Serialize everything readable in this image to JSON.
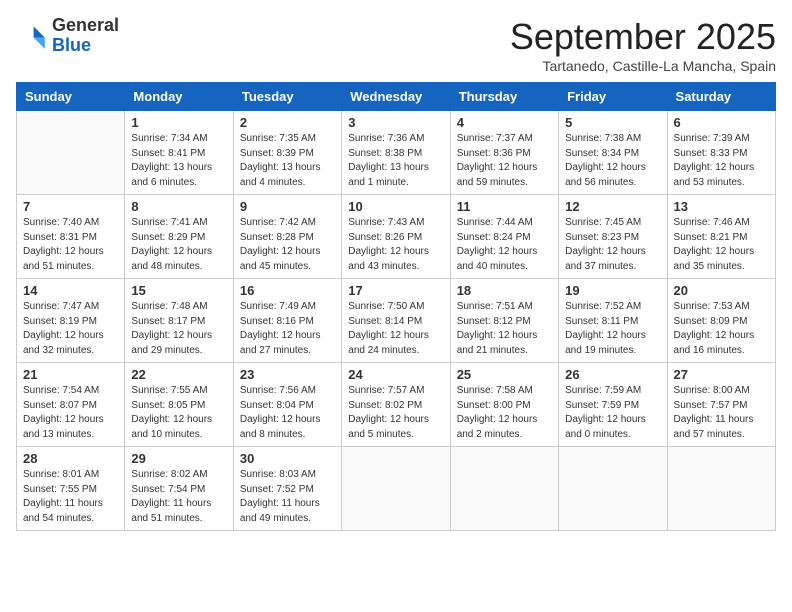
{
  "header": {
    "logo_line1": "General",
    "logo_line2": "Blue",
    "month": "September 2025",
    "location": "Tartanedo, Castille-La Mancha, Spain"
  },
  "days_of_week": [
    "Sunday",
    "Monday",
    "Tuesday",
    "Wednesday",
    "Thursday",
    "Friday",
    "Saturday"
  ],
  "weeks": [
    [
      {
        "day": "",
        "info": ""
      },
      {
        "day": "1",
        "info": "Sunrise: 7:34 AM\nSunset: 8:41 PM\nDaylight: 13 hours\nand 6 minutes."
      },
      {
        "day": "2",
        "info": "Sunrise: 7:35 AM\nSunset: 8:39 PM\nDaylight: 13 hours\nand 4 minutes."
      },
      {
        "day": "3",
        "info": "Sunrise: 7:36 AM\nSunset: 8:38 PM\nDaylight: 13 hours\nand 1 minute."
      },
      {
        "day": "4",
        "info": "Sunrise: 7:37 AM\nSunset: 8:36 PM\nDaylight: 12 hours\nand 59 minutes."
      },
      {
        "day": "5",
        "info": "Sunrise: 7:38 AM\nSunset: 8:34 PM\nDaylight: 12 hours\nand 56 minutes."
      },
      {
        "day": "6",
        "info": "Sunrise: 7:39 AM\nSunset: 8:33 PM\nDaylight: 12 hours\nand 53 minutes."
      }
    ],
    [
      {
        "day": "7",
        "info": "Sunrise: 7:40 AM\nSunset: 8:31 PM\nDaylight: 12 hours\nand 51 minutes."
      },
      {
        "day": "8",
        "info": "Sunrise: 7:41 AM\nSunset: 8:29 PM\nDaylight: 12 hours\nand 48 minutes."
      },
      {
        "day": "9",
        "info": "Sunrise: 7:42 AM\nSunset: 8:28 PM\nDaylight: 12 hours\nand 45 minutes."
      },
      {
        "day": "10",
        "info": "Sunrise: 7:43 AM\nSunset: 8:26 PM\nDaylight: 12 hours\nand 43 minutes."
      },
      {
        "day": "11",
        "info": "Sunrise: 7:44 AM\nSunset: 8:24 PM\nDaylight: 12 hours\nand 40 minutes."
      },
      {
        "day": "12",
        "info": "Sunrise: 7:45 AM\nSunset: 8:23 PM\nDaylight: 12 hours\nand 37 minutes."
      },
      {
        "day": "13",
        "info": "Sunrise: 7:46 AM\nSunset: 8:21 PM\nDaylight: 12 hours\nand 35 minutes."
      }
    ],
    [
      {
        "day": "14",
        "info": "Sunrise: 7:47 AM\nSunset: 8:19 PM\nDaylight: 12 hours\nand 32 minutes."
      },
      {
        "day": "15",
        "info": "Sunrise: 7:48 AM\nSunset: 8:17 PM\nDaylight: 12 hours\nand 29 minutes."
      },
      {
        "day": "16",
        "info": "Sunrise: 7:49 AM\nSunset: 8:16 PM\nDaylight: 12 hours\nand 27 minutes."
      },
      {
        "day": "17",
        "info": "Sunrise: 7:50 AM\nSunset: 8:14 PM\nDaylight: 12 hours\nand 24 minutes."
      },
      {
        "day": "18",
        "info": "Sunrise: 7:51 AM\nSunset: 8:12 PM\nDaylight: 12 hours\nand 21 minutes."
      },
      {
        "day": "19",
        "info": "Sunrise: 7:52 AM\nSunset: 8:11 PM\nDaylight: 12 hours\nand 19 minutes."
      },
      {
        "day": "20",
        "info": "Sunrise: 7:53 AM\nSunset: 8:09 PM\nDaylight: 12 hours\nand 16 minutes."
      }
    ],
    [
      {
        "day": "21",
        "info": "Sunrise: 7:54 AM\nSunset: 8:07 PM\nDaylight: 12 hours\nand 13 minutes."
      },
      {
        "day": "22",
        "info": "Sunrise: 7:55 AM\nSunset: 8:05 PM\nDaylight: 12 hours\nand 10 minutes."
      },
      {
        "day": "23",
        "info": "Sunrise: 7:56 AM\nSunset: 8:04 PM\nDaylight: 12 hours\nand 8 minutes."
      },
      {
        "day": "24",
        "info": "Sunrise: 7:57 AM\nSunset: 8:02 PM\nDaylight: 12 hours\nand 5 minutes."
      },
      {
        "day": "25",
        "info": "Sunrise: 7:58 AM\nSunset: 8:00 PM\nDaylight: 12 hours\nand 2 minutes."
      },
      {
        "day": "26",
        "info": "Sunrise: 7:59 AM\nSunset: 7:59 PM\nDaylight: 12 hours\nand 0 minutes."
      },
      {
        "day": "27",
        "info": "Sunrise: 8:00 AM\nSunset: 7:57 PM\nDaylight: 11 hours\nand 57 minutes."
      }
    ],
    [
      {
        "day": "28",
        "info": "Sunrise: 8:01 AM\nSunset: 7:55 PM\nDaylight: 11 hours\nand 54 minutes."
      },
      {
        "day": "29",
        "info": "Sunrise: 8:02 AM\nSunset: 7:54 PM\nDaylight: 11 hours\nand 51 minutes."
      },
      {
        "day": "30",
        "info": "Sunrise: 8:03 AM\nSunset: 7:52 PM\nDaylight: 11 hours\nand 49 minutes."
      },
      {
        "day": "",
        "info": ""
      },
      {
        "day": "",
        "info": ""
      },
      {
        "day": "",
        "info": ""
      },
      {
        "day": "",
        "info": ""
      }
    ]
  ]
}
